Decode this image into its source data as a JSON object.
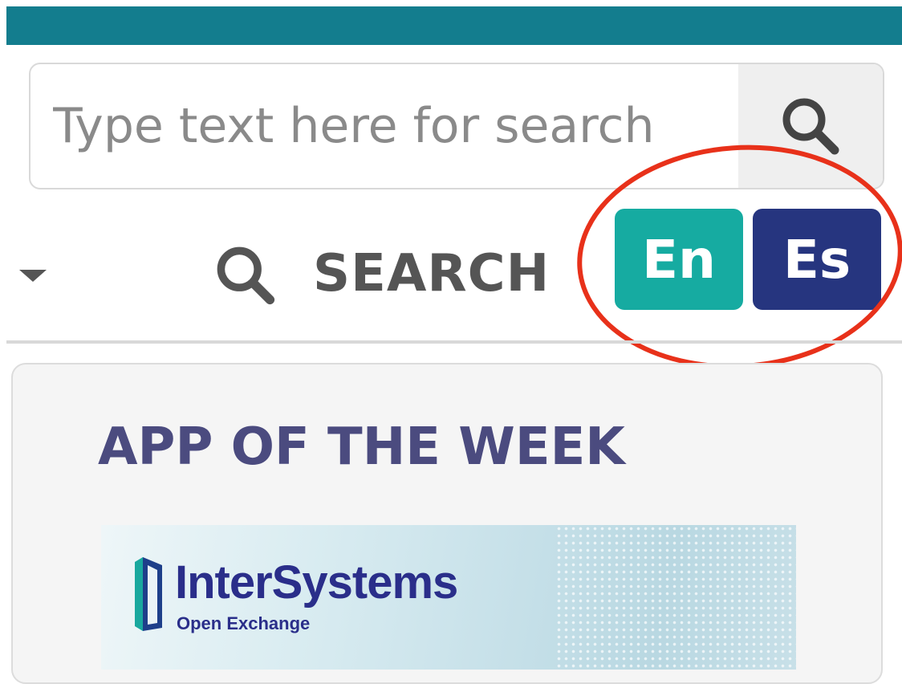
{
  "colors": {
    "top_bar": "#137d8e",
    "lang_en_bg": "#16aba1",
    "lang_es_bg": "#26357f",
    "card_title": "#4b4b7f",
    "annotation": "#e8311a"
  },
  "search": {
    "placeholder": "Type text here for search",
    "value": "",
    "button_icon": "search-icon"
  },
  "nav": {
    "dropdown_icon": "caret-down-icon",
    "search_label": "SEARCH"
  },
  "language": {
    "options": [
      {
        "label": "En"
      },
      {
        "label": "Es"
      }
    ]
  },
  "app_of_week": {
    "title": "APP OF THE WEEK",
    "banner": {
      "brand": "InterSystems",
      "subtitle": "Open Exchange"
    }
  }
}
